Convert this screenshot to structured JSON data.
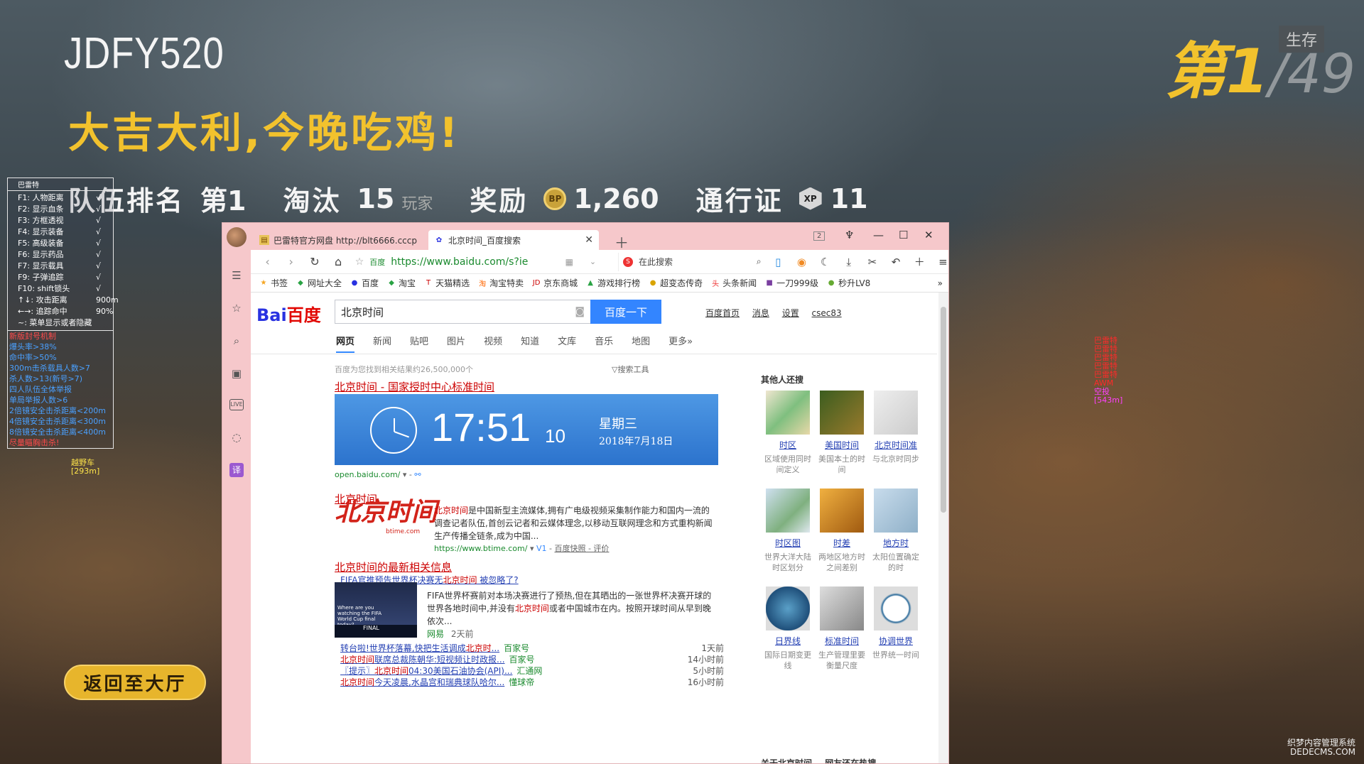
{
  "hud": {
    "player_name": "JDFY520",
    "slogan": "大吉大利,今晚吃鸡!",
    "team_rank_label": "队伍排名",
    "team_rank_value": "第1",
    "kills_label": "淘汰",
    "kills_value": "15",
    "kills_unit": "玩家",
    "reward_label": "奖励",
    "bp_icon": "BP",
    "reward_value": "1,260",
    "pass_label": "通行证",
    "xp_icon": "XP",
    "pass_value": "11",
    "rank_place": "第1",
    "rank_total": "/49",
    "alive_label": "生存",
    "back_button": "返回至大厅"
  },
  "colors": {
    "hud_yellow": "#f2c22d",
    "baidu_blue": "#3385ff",
    "result_red": "#c00000",
    "link_blue": "#2440b3",
    "url_green": "#1a8a2e",
    "browser_chrome": "#f6c8cb"
  },
  "cheat": {
    "title": "巴雷特",
    "keys": [
      {
        "k": "F1: 人物距离",
        "v": "√"
      },
      {
        "k": "F2: 显示血条",
        "v": "√"
      },
      {
        "k": "F3: 方框透视",
        "v": "√"
      },
      {
        "k": "F4: 显示装备",
        "v": "√"
      },
      {
        "k": "F5: 高级装备",
        "v": "√"
      },
      {
        "k": "F6: 显示药品",
        "v": "√"
      },
      {
        "k": "F7: 显示载具",
        "v": "√"
      },
      {
        "k": "F9: 子弹追踪",
        "v": "√"
      },
      {
        "k": "F10: shift锁头",
        "v": "√"
      },
      {
        "k": "↑↓: 攻击距离",
        "v": "900m"
      },
      {
        "k": "←→: 追踪命中",
        "v": "90%"
      },
      {
        "k": "~: 菜单显示或者隐藏",
        "v": ""
      }
    ],
    "warn_title": "新版封号机制",
    "warnings": [
      "爆头率>38%",
      "命中率>50%",
      "300m击杀载具人数>7",
      "杀人数>13(新号>7)",
      "四人队伍全体举报",
      "单局举报人数>6",
      "2倍镜安全击杀距离<200m",
      "4倍镜安全击杀距离<300m",
      "8倍镜安全击杀距离<400m"
    ],
    "warn_footer": "尽量瞄胸击杀!",
    "vehicle_name": "越野车",
    "vehicle_dist": "[293m]",
    "marker_lines": [
      "巴雷特",
      "巴雷特",
      "巴雷特",
      "巴雷特",
      "巴雷特"
    ],
    "marker_gun": "AWM",
    "marker_item": "空投",
    "marker_dist": "[543m]"
  },
  "watermark": {
    "line1": "织梦内容管理系统",
    "line2": "DEDECMS.COM"
  },
  "browser": {
    "tabs": [
      {
        "label": "巴雷特官方网盘 http://blt6666.cccp",
        "icon": "folder-icon"
      },
      {
        "label": "北京时间_百度搜索",
        "icon": "baidu-paw-icon"
      }
    ],
    "tab_count": "2",
    "url_secure": "百度",
    "url": "https://www.baidu.com/s?ie",
    "search_placeholder": "在此搜索",
    "bookmarks": [
      {
        "label": "书签",
        "icon": "★",
        "color": "#f5a623"
      },
      {
        "label": "网址大全",
        "icon": "◆",
        "color": "#2aa344"
      },
      {
        "label": "百度",
        "icon": "●",
        "color": "#2932e1"
      },
      {
        "label": "淘宝",
        "icon": "◆",
        "color": "#2aa344"
      },
      {
        "label": "天猫精选",
        "icon": "T",
        "color": "#c00"
      },
      {
        "label": "淘宝特卖",
        "icon": "淘",
        "color": "#f60"
      },
      {
        "label": "京东商城",
        "icon": "JD",
        "color": "#c00"
      },
      {
        "label": "游戏排行榜",
        "icon": "▲",
        "color": "#2aa344"
      },
      {
        "label": "超变态传奇",
        "icon": "●",
        "color": "#d9a400"
      },
      {
        "label": "头条新闻",
        "icon": "头",
        "color": "#e33"
      },
      {
        "label": "一刀999级",
        "icon": "■",
        "color": "#7a3fa0"
      },
      {
        "label": "秒升LV8",
        "icon": "●",
        "color": "#6a3"
      }
    ],
    "more": "»"
  },
  "baidu": {
    "logo_a": "Bai",
    "logo_b": "百度",
    "query": "北京时间",
    "search_button": "百度一下",
    "top_links": [
      "百度首页",
      "消息",
      "设置",
      "csec83"
    ],
    "tabs": [
      "网页",
      "新闻",
      "贴吧",
      "图片",
      "视频",
      "知道",
      "文库",
      "音乐",
      "地图",
      "更多»"
    ],
    "result_count": "百度为您找到相关结果约26,500,000个",
    "search_tools": "搜索工具",
    "r1_title": "北京时间 - 国家授时中心标准时间",
    "clock": {
      "time": "17:51",
      "seconds": "10",
      "weekday": "星期三",
      "date": "2018年7月18日"
    },
    "r1_url": "open.baidu.com/",
    "r2_title": "北京时间",
    "r2_logo": "北京时间",
    "r2_logo_sub": "btime.com",
    "r2_snippet_em": "北京时间",
    "r2_snippet": "是中国新型主流媒体,拥有广电级视频采集制作能力和国内一流的调查记者队伍,首创云记者和云媒体理念,以移动互联网理念和方式重构新闻生产传播全链条,成为中国...",
    "r2_url": "https://www.btime.com/",
    "r2_v": "V1",
    "r2_links": "百度快照 - 评价",
    "r3_title": "北京时间的最新相关信息",
    "r3_sub_a": "FIFA官推预告世界杯决赛无",
    "r3_sub_em": "北京时间",
    "r3_sub_b": " 被忽略了?",
    "r3_snippet_a": "FIFA世界杯赛前对本场决赛进行了预热,但在其晒出的一张世界杯决赛开球的世界各地时间中,并没有",
    "r3_snippet_em": "北京时间",
    "r3_snippet_b": "或者中国城市在内。按照开球时间从早到晚依次...",
    "r3_src": "网易",
    "r3_time": "2天前",
    "thumb_text": "Where are you watching the FIFA World Cup final today?",
    "thumb_banner": "FINAL",
    "news": [
      {
        "a": "转台啦!世界杯落幕,快把生活调成",
        "em": "北京时",
        "b": "...",
        "src": "百家号",
        "time": "1天前"
      },
      {
        "a": "",
        "em": "北京时间",
        "b": "联席总裁陈朝华:短视频让时政报...",
        "src": "百家号",
        "time": "14小时前"
      },
      {
        "a": "〖提示〗",
        "em": "北京时间",
        "b": "04:30美国石油协会(API)...",
        "src": "汇通网",
        "time": "5小时前"
      },
      {
        "a": "",
        "em": "北京时间",
        "b": "今天凌晨,水晶宫和瑞典球队哈尔...",
        "src": "懂球帝",
        "time": "16小时前"
      }
    ],
    "side_title": "其他人还搜",
    "side": [
      {
        "name": "时区",
        "desc": "区域使用同时间定义"
      },
      {
        "name": "美国时间",
        "desc": "美国本土的时间"
      },
      {
        "name": "北京时间准",
        "desc": "与北京时同步"
      },
      {
        "name": "时区图",
        "desc": "世界大洋大陆时区划分"
      },
      {
        "name": "时差",
        "desc": "两地区地方时之间差别"
      },
      {
        "name": "地方时",
        "desc": "太阳位置确定的时"
      },
      {
        "name": "日界线",
        "desc": "国际日期变更线"
      },
      {
        "name": "标准时间",
        "desc": "生产管理里要衡量尺度"
      },
      {
        "name": "协调世界",
        "desc": "世界统一时间"
      }
    ],
    "side_bottom_a": "关于北京时间",
    "side_bottom_b": "网友还在热搜"
  }
}
